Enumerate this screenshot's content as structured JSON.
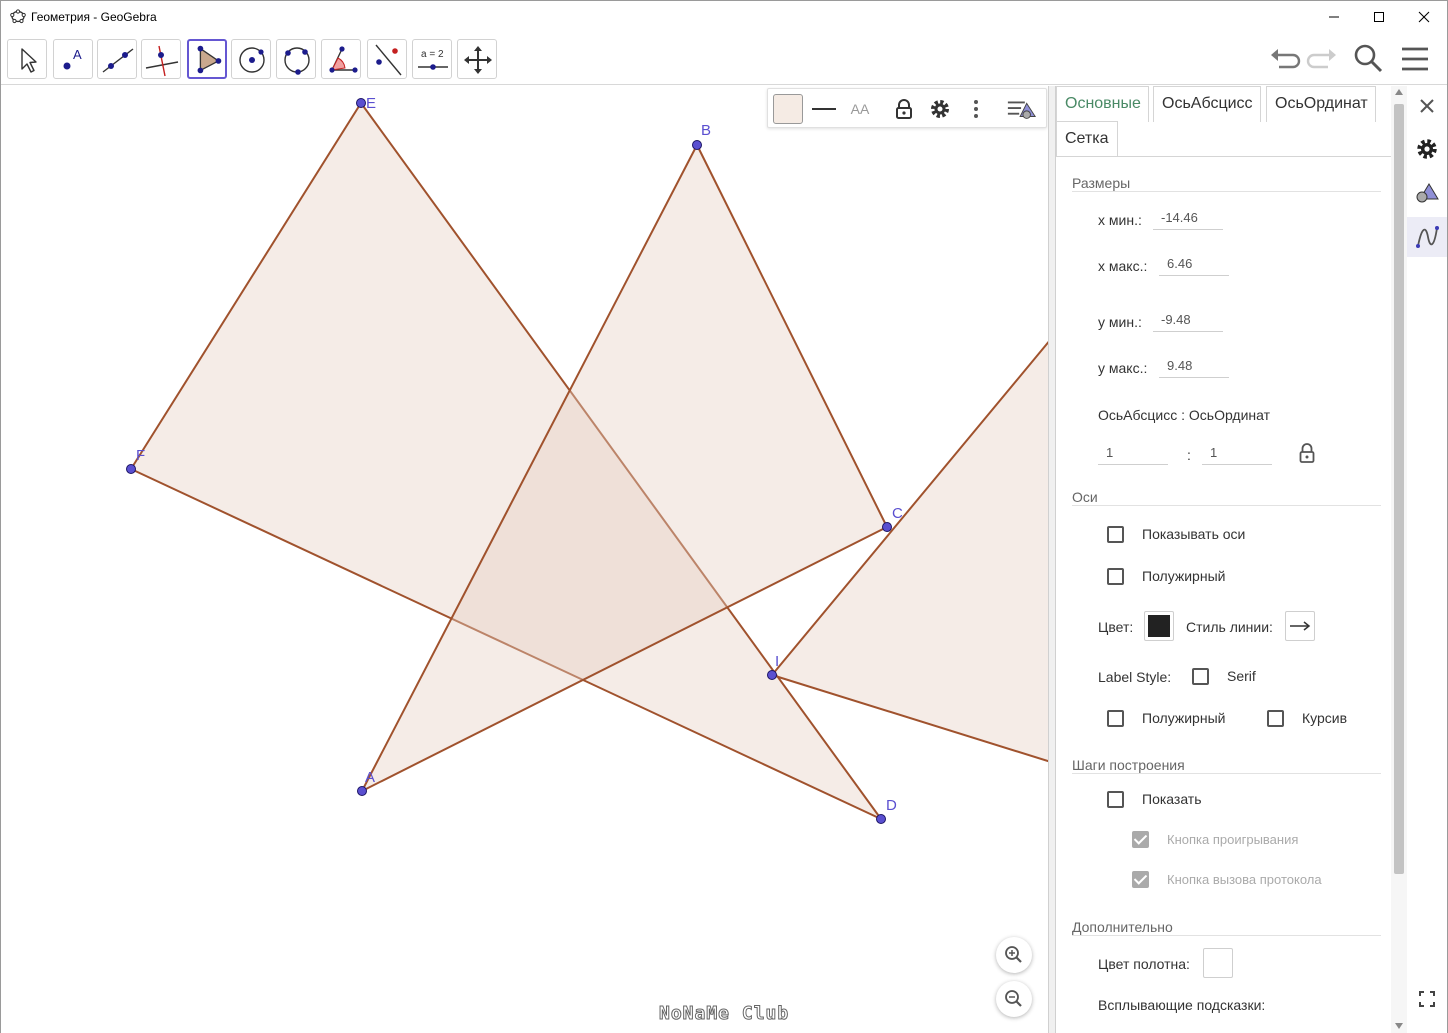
{
  "window": {
    "title": "Геометрия - GeoGebra"
  },
  "toolbar": {
    "tools": [
      {
        "icon": "move-arrow-icon"
      },
      {
        "icon": "point-icon",
        "label": "A"
      },
      {
        "icon": "line-icon"
      },
      {
        "icon": "perpendicular-line-icon"
      },
      {
        "icon": "polygon-icon",
        "active": true
      },
      {
        "icon": "circle-center-point-icon"
      },
      {
        "icon": "circle-three-points-icon"
      },
      {
        "icon": "angle-icon"
      },
      {
        "icon": "reflect-about-line-icon"
      },
      {
        "icon": "slider-icon",
        "label": "a = 2"
      },
      {
        "icon": "move-graphics-view-icon"
      }
    ],
    "right": [
      "undo-icon",
      "redo-icon",
      "search-icon",
      "menu-icon"
    ]
  },
  "graphics": {
    "points": [
      {
        "name": "E",
        "label": "E"
      },
      {
        "name": "B",
        "label": "B"
      },
      {
        "name": "F",
        "label": "F"
      },
      {
        "name": "C",
        "label": "C"
      },
      {
        "name": "I",
        "label": "I"
      },
      {
        "name": "A",
        "label": "A"
      },
      {
        "name": "D",
        "label": "D"
      }
    ],
    "polygon_fill": "#e6cfc2",
    "polygon_stroke": "#a0522d",
    "point_color": "#5a4fd0",
    "watermark": "NoNaMe Club",
    "style_bar": {
      "text_size_label": "AA"
    }
  },
  "properties": {
    "tabs": [
      {
        "label": "Основные",
        "active": true
      },
      {
        "label": "ОсьАбсцисс"
      },
      {
        "label": "ОсьОрдинат"
      },
      {
        "label": "Сетка"
      }
    ],
    "dimensions": {
      "title": "Размеры",
      "xmin_label": "x мин.:",
      "xmin": "-14.46",
      "xmax_label": "x макс.:",
      "xmax": "6.46",
      "ymin_label": "y мин.:",
      "ymin": "-9.48",
      "ymax_label": "y макс.:",
      "ymax": "9.48",
      "ratio_label": "ОсьАбсцисс : ОсьОрдинат",
      "ratio_x": "1",
      "ratio_sep": ":",
      "ratio_y": "1"
    },
    "axes": {
      "title": "Оси",
      "show_axes": "Показывать оси",
      "bold": "Полужирный",
      "color_label": "Цвет:",
      "color": "#222222",
      "line_style_label": "Стиль линии:",
      "label_style_label": "Label Style:",
      "serif": "Serif",
      "bold2": "Полужирный",
      "italic": "Курсив"
    },
    "construction": {
      "title": "Шаги построения",
      "show": "Показать",
      "play_button": "Кнопка проигрывания",
      "protocol_button": "Кнопка вызова протокола"
    },
    "advanced": {
      "title": "Дополнительно",
      "bg_color_label": "Цвет полотна:",
      "bg_color": "#ffffff",
      "tooltips_label": "Всплывающие подсказки:"
    }
  },
  "sidebar": [
    "close-icon",
    "gear-icon",
    "graphics-view-icon",
    "algebra-view-icon",
    "fullscreen-icon"
  ]
}
